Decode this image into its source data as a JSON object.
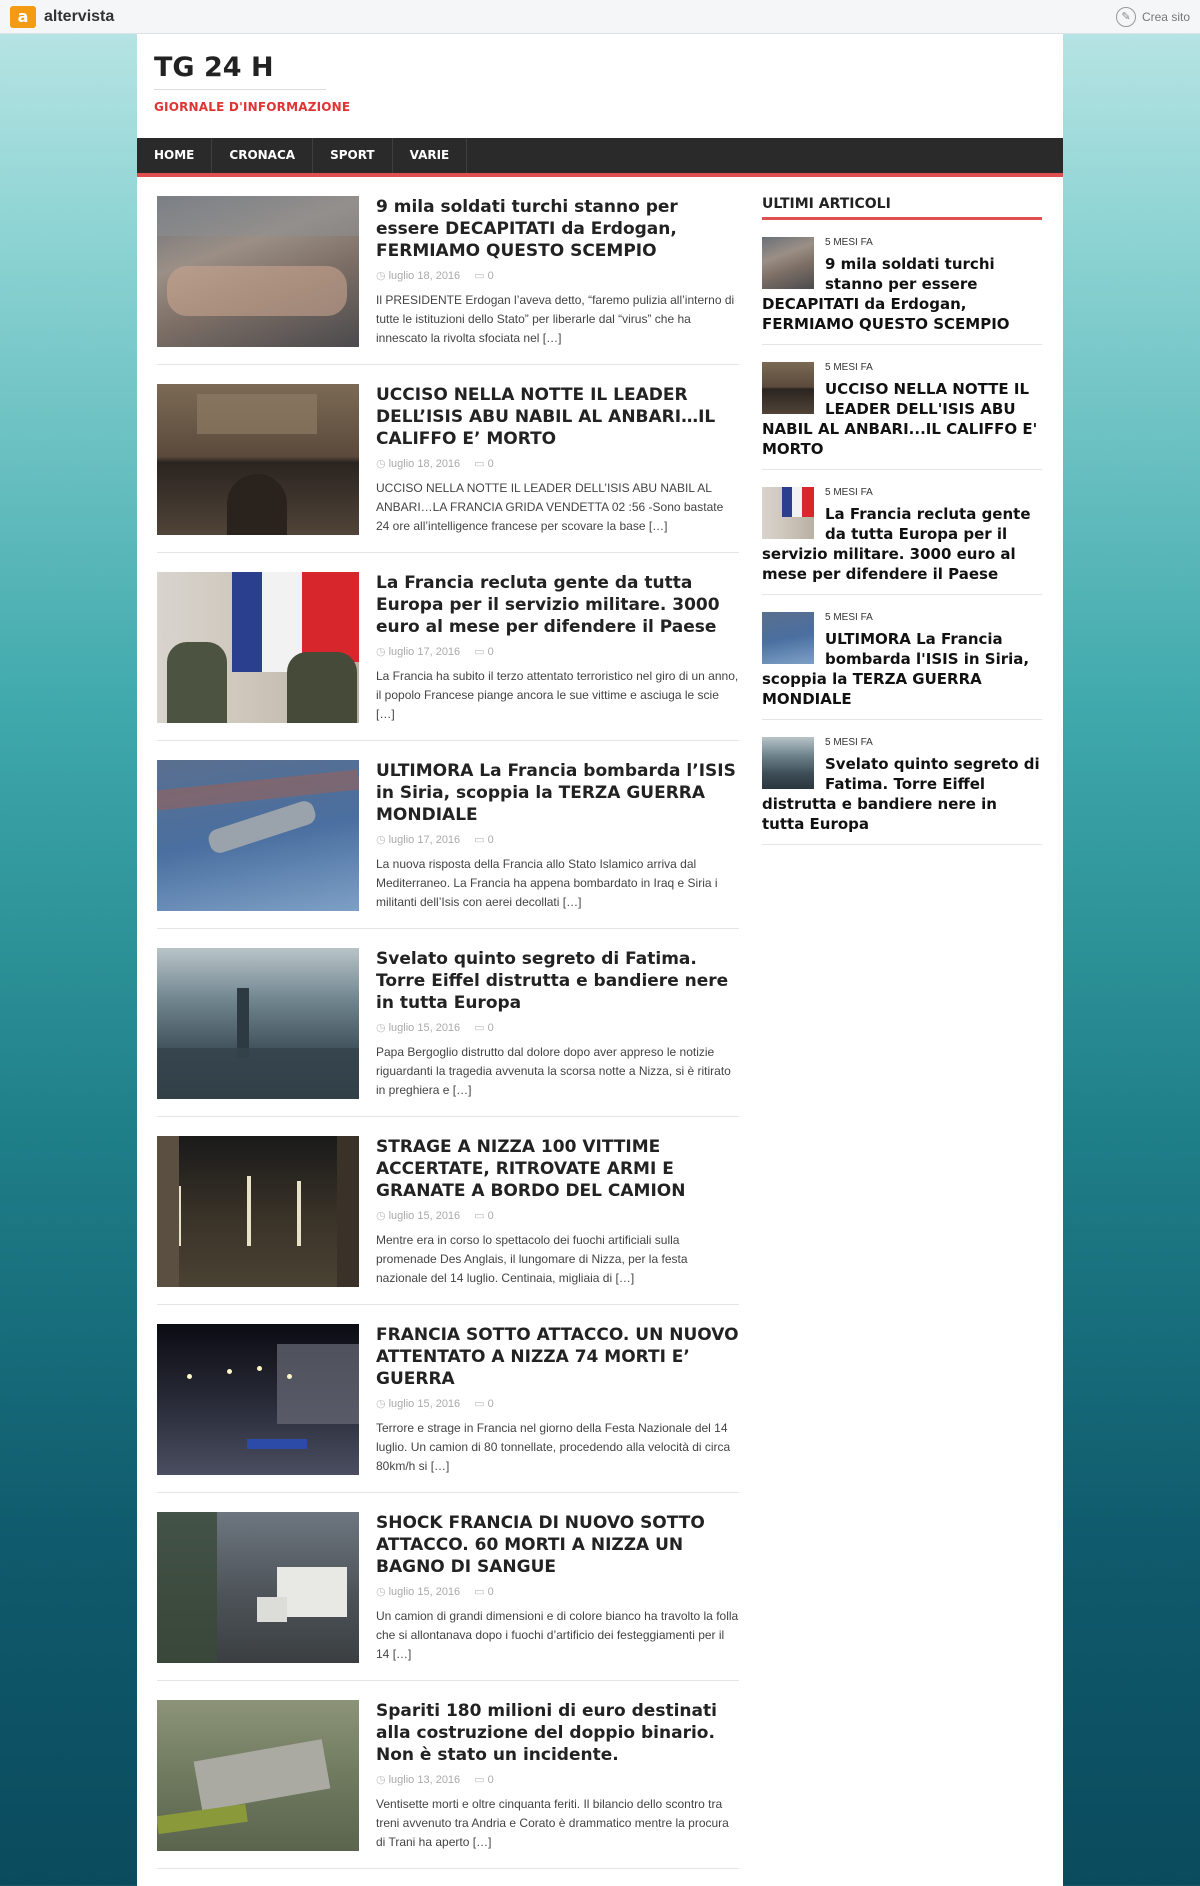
{
  "topbar": {
    "brand_logo": "a",
    "brand_name": "altervista",
    "crea_label": "Crea sito",
    "crea_icon": "pencil-icon"
  },
  "site": {
    "title": "TG 24 H",
    "description": "GIORNALE D'INFORMAZIONE"
  },
  "nav": [
    "HOME",
    "CRONACA",
    "SPORT",
    "VARIE"
  ],
  "articles": [
    {
      "title": "9 mila soldati turchi stanno per essere DECAPITATI da Erdogan, FERMIAMO QUESTO SCEMPIO",
      "date": "luglio 18, 2016",
      "comments": "0",
      "excerpt": "Il PRESIDENTE Erdogan l’aveva detto, “faremo pulizia all’interno di tutte le istituzioni dello Stato” per liberarle dal “virus” che ha innescato la rivolta sfociata nel",
      "more": "[…]"
    },
    {
      "title": "UCCISO NELLA NOTTE IL LEADER DELL’ISIS ABU NABIL AL ANBARI…IL CALIFFO E’ MORTO",
      "date": "luglio 18, 2016",
      "comments": "0",
      "excerpt": "UCCISO NELLA NOTTE IL LEADER DELL’ISIS ABU NABIL AL ANBARI…LA FRANCIA GRIDA VENDETTA 02 :56 -Sono bastate 24 ore  all’intelligence francese per scovare la base",
      "more": "[…]"
    },
    {
      "title": "La Francia recluta gente da tutta Europa per il servizio militare. 3000 euro al mese per difendere il Paese",
      "date": "luglio 17, 2016",
      "comments": "0",
      "excerpt": "La Francia ha subito il terzo attentato terroristico nel giro di un anno, il popolo Francese piange ancora le sue vittime e asciuga le scie",
      "more": "[…]"
    },
    {
      "title": "ULTIMORA La Francia bombarda l’ISIS in Siria, scoppia la TERZA GUERRA MONDIALE",
      "date": "luglio 17, 2016",
      "comments": "0",
      "excerpt": "La nuova risposta della Francia allo Stato Islamico arriva dal Mediterraneo. La Francia ha appena bombardato in  Iraq e Siria i militanti dell’Isis con aerei decollati",
      "more": "[…]"
    },
    {
      "title": "Svelato quinto segreto di Fatima. Torre Eiffel distrutta e bandiere nere in tutta Europa",
      "date": "luglio 15, 2016",
      "comments": "0",
      "excerpt": "Papa Bergoglio distrutto dal dolore dopo aver appreso le notizie riguardanti la tragedia avvenuta la scorsa notte a Nizza, si è ritirato in preghiera e",
      "more": "[…]"
    },
    {
      "title": "STRAGE A NIZZA 100 VITTIME ACCERTATE, RITROVATE ARMI E GRANATE A BORDO DEL CAMION",
      "date": "luglio 15, 2016",
      "comments": "0",
      "excerpt": "Mentre era in corso lo spettacolo dei fuochi artificiali sulla promenade Des Anglais, il lungomare di Nizza, per la festa nazionale del 14 luglio. Centinaia, migliaia di",
      "more": "[…]"
    },
    {
      "title": "FRANCIA SOTTO ATTACCO. UN NUOVO ATTENTATO A NIZZA 74 MORTI E’ GUERRA",
      "date": "luglio 15, 2016",
      "comments": "0",
      "excerpt": "Terrore e strage in Francia nel giorno della Festa Nazionale del 14 luglio. Un camion di 80 tonnellate, procedendo alla velocità di circa 80km/h si",
      "more": "[…]"
    },
    {
      "title": "SHOCK FRANCIA DI NUOVO SOTTO ATTACCO. 60 MORTI A NIZZA UN BAGNO DI SANGUE",
      "date": "luglio 15, 2016",
      "comments": "0",
      "excerpt": "Un camion di grandi dimensioni e di colore bianco ha travolto la folla che si allontanava dopo i fuochi d’artificio dei festeggiamenti per il 14",
      "more": "[…]"
    },
    {
      "title": "Spariti 180 milioni di euro destinati alla costruzione del doppio binario. Non è stato un incidente.",
      "date": "luglio 13, 2016",
      "comments": "0",
      "excerpt": "Ventisette morti e oltre cinquanta feriti. Il bilancio dello scontro tra treni avvenuto tra Andria e Corato è drammatico mentre la procura di Trani ha aperto",
      "more": "[…]"
    }
  ],
  "sidebar": {
    "title": "ULTIMI ARTICOLI",
    "items": [
      {
        "ago": "5 MESI FA",
        "title": "9 mila soldati turchi stanno per essere DECAPITATI da Erdogan, FERMIAMO QUESTO SCEMPIO"
      },
      {
        "ago": "5 MESI FA",
        "title": "UCCISO NELLA NOTTE IL LEADER DELL'ISIS ABU NABIL AL ANBARI...IL CALIFFO E' MORTO"
      },
      {
        "ago": "5 MESI FA",
        "title": "La Francia recluta gente da tutta Europa per il servizio militare. 3000 euro al mese per difendere il Paese"
      },
      {
        "ago": "5 MESI FA",
        "title": "ULTIMORA La Francia bombarda l'ISIS in Siria, scoppia la TERZA GUERRA MONDIALE"
      },
      {
        "ago": "5 MESI FA",
        "title": "Svelato quinto segreto di Fatima. Torre Eiffel distrutta e bandiere nere in tutta Europa"
      }
    ]
  },
  "icons": {
    "clock": "clock-icon",
    "comment": "comment-icon"
  }
}
